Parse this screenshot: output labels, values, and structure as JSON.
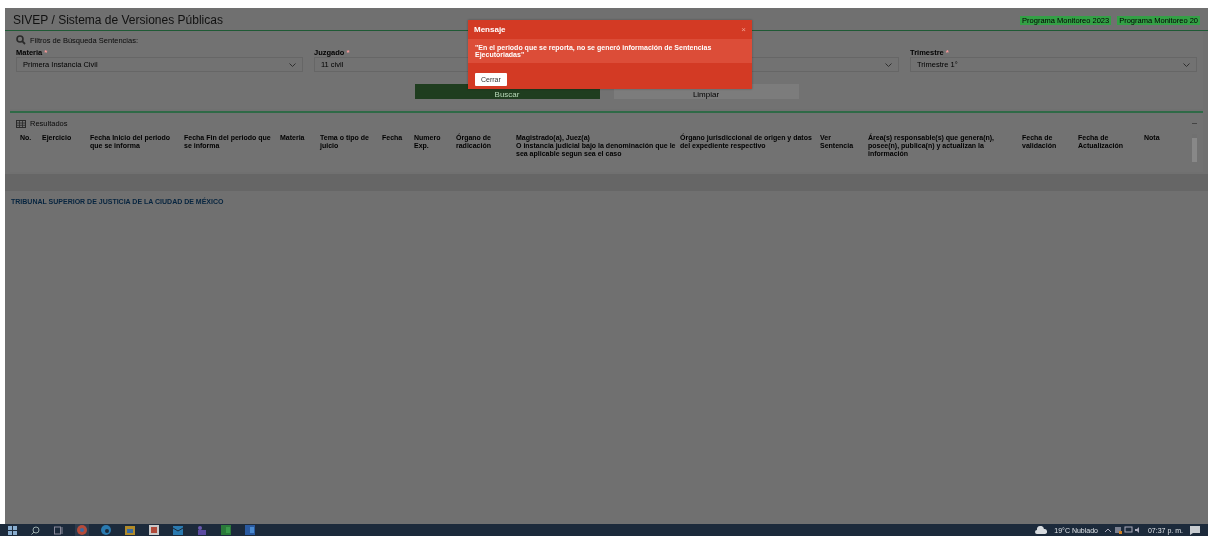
{
  "header": {
    "title": "SIVEP / Sistema de Versiones Públicas",
    "links": [
      "Programa Monitoreo 2023",
      "Programa Monitoreo 20"
    ]
  },
  "filters": {
    "title": "Filtros de Búsqueda Sentencias:",
    "fields": [
      {
        "kind": "select",
        "label": "Materia",
        "marker": "*",
        "value": "Primera Instancia Civil"
      },
      {
        "kind": "select",
        "label": "Juzgado",
        "marker": "*",
        "value": "11 civil"
      },
      {
        "kind": "select"
      },
      {
        "kind": "select",
        "label": "Trimestre",
        "marker": "*",
        "value": "Trimestre 1°"
      }
    ],
    "buttons": [
      {
        "label": "Buscar",
        "kind": "primary"
      },
      {
        "label": "Limpiar",
        "kind": "secondary"
      }
    ]
  },
  "results": {
    "title": "Resultados",
    "columns": [
      "No.",
      "Ejercicio",
      "Fecha Inicio del periodo que se informa",
      "Fecha Fin del periodo que se informa",
      "Materia",
      "Tema o tipo de juicio",
      "Fecha",
      "Numero Exp.",
      "Órgano de radicación",
      "Magistrado(a), Juez(a)\nO instancia judicial bajo la denominación que le sea aplicable segun sea el caso",
      "Órgano jurisdiccional de origen y datos del expediente respectivo",
      "Ver Sentencia",
      "Área(s) responsable(s) que genera(n), posee(n), publica(n) y actualizan la información",
      "Fecha de validación",
      "Fecha de Actualización",
      "Nota"
    ]
  },
  "footer": "TRIBUNAL SUPERIOR DE JUSTICIA DE LA CIUDAD DE MÉXICO",
  "modal": {
    "title": "Mensaje",
    "close": "×",
    "message": "\"En el periodo que se reporta, no se generó información de Sentencias Ejecutoriadas\"",
    "button": "Cerrar"
  },
  "taskbar": {
    "weather": "19°C  Nublado",
    "time": "07:37 p. m."
  }
}
